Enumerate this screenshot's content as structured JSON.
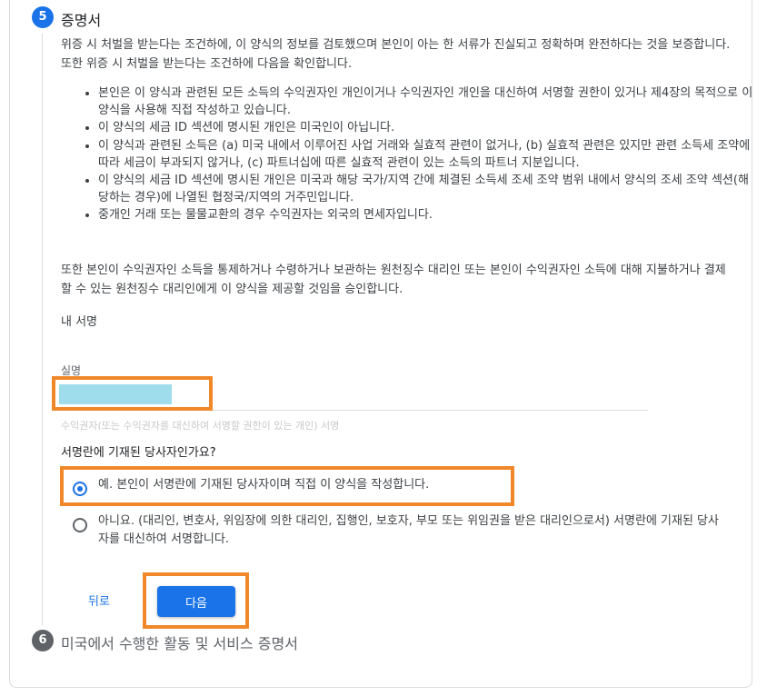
{
  "step5": {
    "number": "5",
    "title": "증명서",
    "intro": "위증 시 처벌을 받는다는 조건하에, 이 양식의 정보를 검토했으며 본인이 아는 한 서류가 진실되고 정확하며 완전하다는 것을 보증합니다. 또한 위증 시 처벌을 받는다는 조건하에 다음을 확인합니다.",
    "bullets": [
      "본인은 이 양식과 관련된 모든 소득의 수익권자인 개인이거나 수익권자인 개인을 대신하여 서명할 권한이 있거나 제4장의 목적으로 이 양식을 사용해 직접 작성하고 있습니다.",
      "이 양식의 세금 ID 섹션에 명시된 개인은 미국인이 아닙니다.",
      "이 양식과 관련된 소득은 (a) 미국 내에서 이루어진 사업 거래와 실효적 관련이 없거나, (b) 실효적 관련은 있지만 관련 소득세 조약에 따라 세금이 부과되지 않거나, (c) 파트너십에 따른 실효적 관련이 있는 소득의 파트너 지분입니다.",
      "이 양식의 세금 ID 섹션에 명시된 개인은 미국과 해당 국가/지역 간에 체결된 소득세 조세 조약 범위 내에서 양식의 조세 조약 섹션(해당하는 경우)에 나열된 협정국/지역의 거주민입니다.",
      "중개인 거래 또는 물물교환의 경우 수익권자는 외국의 면세자입니다."
    ],
    "authorization": "또한 본인이 수익권자인 소득을 통제하거나 수령하거나 보관하는 원천징수 대리인 또는 본인이 수익권자인 소득에 대해 지불하거나 결제할 수 있는 원천징수 대리인에게 이 양식을 제공할 것임을 승인합니다.",
    "signature_heading": "내 서명",
    "name_field": {
      "label": "실명",
      "value": "",
      "helper": "수익권자(또는 수익권자를 대신하여 서명할 권한이 있는 개인) 서명"
    },
    "question": "서명란에 기재된 당사자인가요?",
    "options": {
      "yes": "예. 본인이 서명란에 기재된 당사자이며 직접 이 양식을 작성합니다.",
      "no": "아니요. (대리인, 변호사, 위임장에 의한 대리인, 집행인, 보호자, 부모 또는 위임권을 받은 대리인으로서) 서명란에 기재된 당사자를 대신하여 서명합니다.",
      "selected": "yes"
    },
    "back_label": "뒤로",
    "next_label": "다음"
  },
  "step6": {
    "number": "6",
    "title": "미국에서 수행한 활동 및 서비스 증명서"
  },
  "colors": {
    "accent": "#1a73e8",
    "highlight": "#f0882a",
    "redacted_fill": "#9fdcec"
  }
}
